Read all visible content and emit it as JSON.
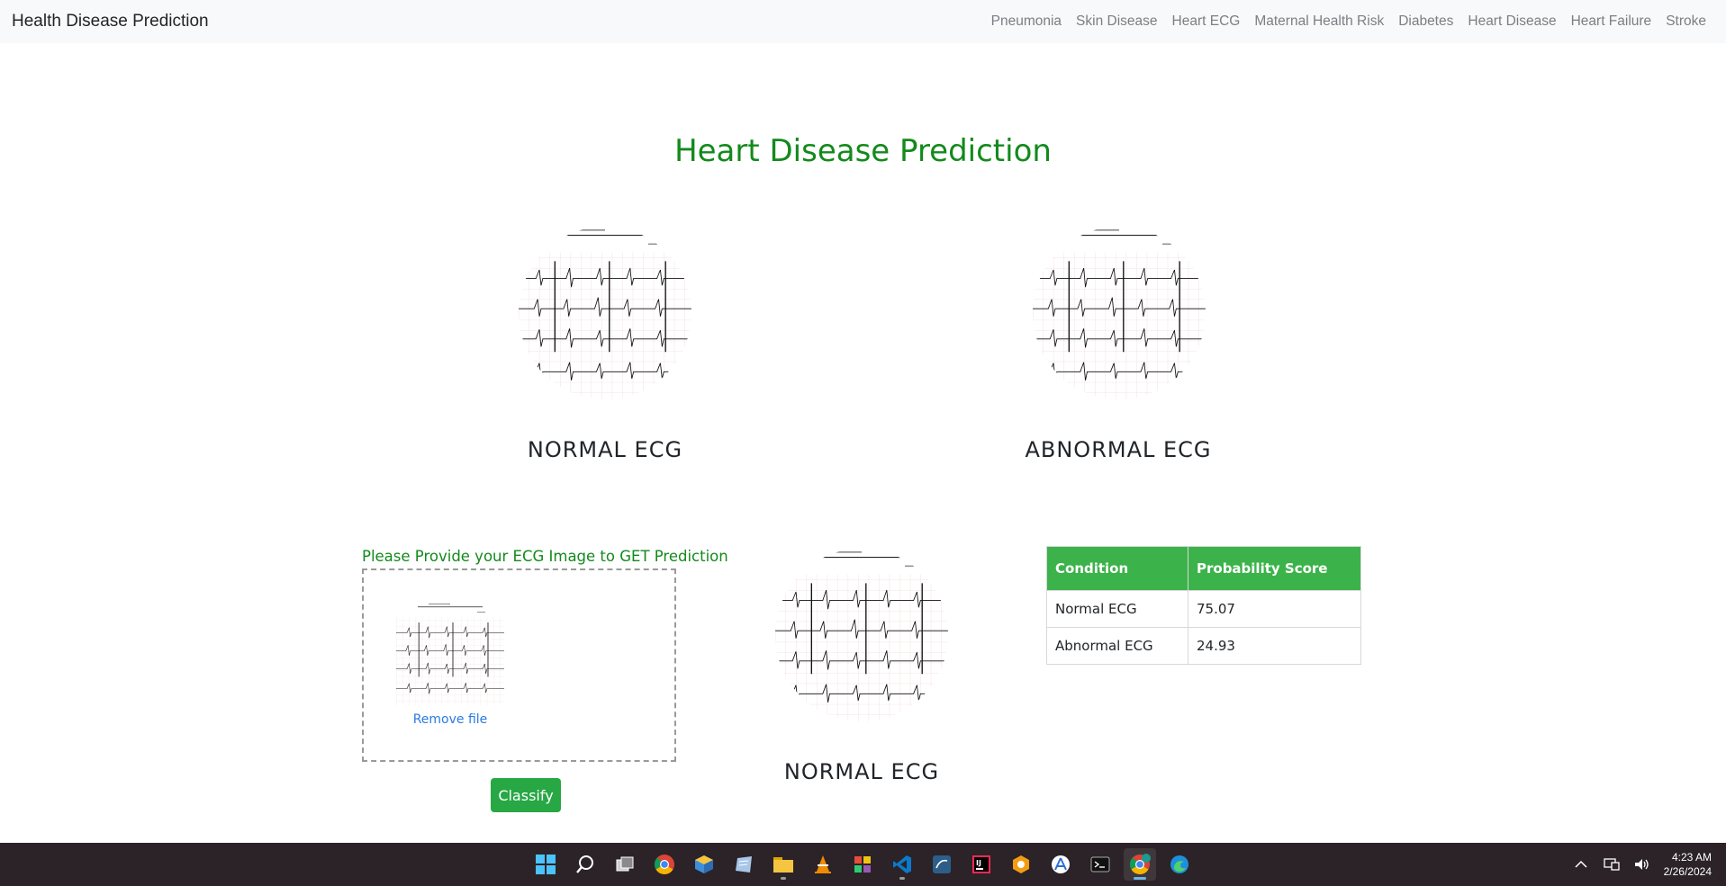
{
  "navbar": {
    "brand": "Health Disease Prediction",
    "links": [
      "Pneumonia",
      "Skin Disease",
      "Heart ECG",
      "Maternal Health Risk",
      "Diabetes",
      "Heart Disease",
      "Heart Failure",
      "Stroke"
    ]
  },
  "page": {
    "title": "Heart Disease Prediction"
  },
  "samples": {
    "normal_label": "NORMAL ECG",
    "abnormal_label": "ABNORMAL ECG"
  },
  "upload": {
    "prompt": "Please Provide your ECG Image to GET Prediction",
    "remove_label": "Remove file",
    "classify_label": "Classify"
  },
  "prediction": {
    "label": "NORMAL ECG"
  },
  "results_table": {
    "headers": [
      "Condition",
      "Probability Score"
    ],
    "rows": [
      [
        "Normal ECG",
        "75.07"
      ],
      [
        "Abnormal ECG",
        "24.93"
      ]
    ]
  },
  "taskbar": {
    "apps": [
      "start-icon",
      "search-icon",
      "task-view-icon",
      "chrome-icon",
      "app-cube-icon",
      "notes-icon",
      "file-explorer-icon",
      "vlc-icon",
      "app-grid-icon",
      "vscode-icon",
      "mysql-workbench-icon",
      "intellij-icon",
      "app-orange-icon",
      "app-store-icon",
      "terminal-icon",
      "chrome-profile-icon",
      "edge-icon"
    ],
    "time": "4:23 AM",
    "date": "2/26/2024"
  },
  "colors": {
    "accent_green": "#138a1c",
    "button_green": "#28a745",
    "table_header": "#3cb34a",
    "link_blue": "#2a7ae2",
    "taskbar_bg": "#2b2327"
  }
}
